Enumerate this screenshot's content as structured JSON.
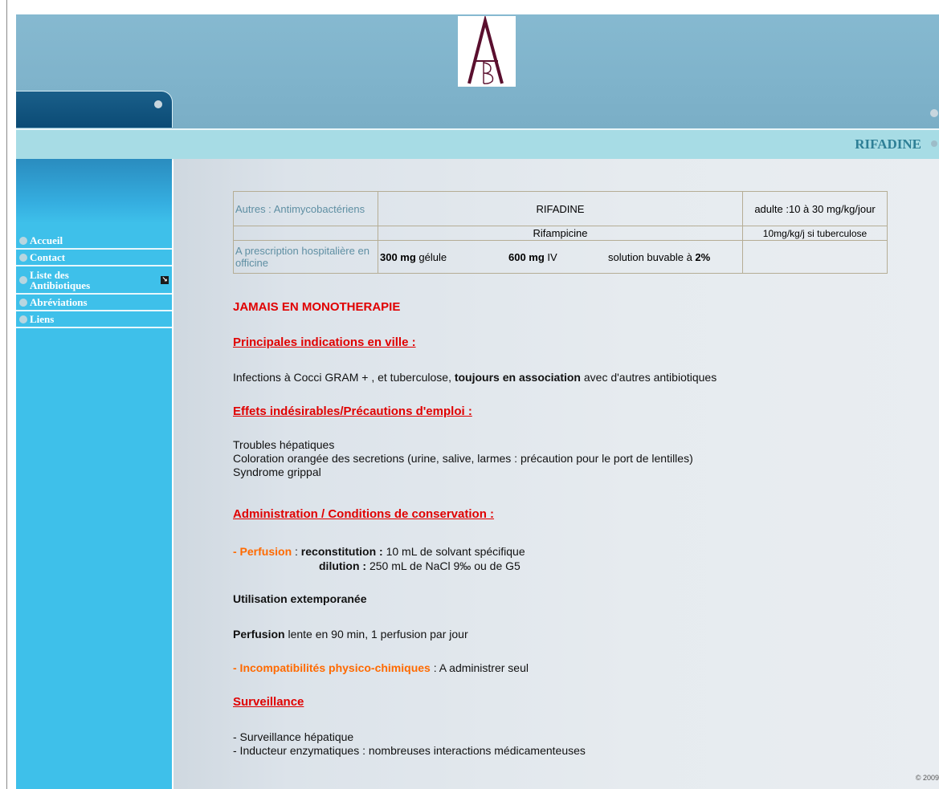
{
  "logo_alt": "AB",
  "header": {
    "title": "RIFADINE"
  },
  "menu": [
    {
      "label": "Accueil"
    },
    {
      "label": "Contact"
    },
    {
      "label": "Liste des Antibiotiques"
    },
    {
      "label": "Abréviations"
    },
    {
      "label": "Liens"
    }
  ],
  "table": {
    "class_label": "Autres : Antimycobactériens",
    "drug_name": "RIFADINE",
    "dose_adult": "adulte :10 à 30 mg/kg/jour",
    "generic_name": "Rifampicine",
    "dose_tb": "10mg/kg/j si tuberculose",
    "prescription": "A prescription hospitalière en officine",
    "form1_dose": "300 mg",
    "form1_type": " gélule",
    "form2_dose": "600 mg",
    "form2_type": " IV",
    "form3_text": "solution buvable à ",
    "form3_dose": "2%"
  },
  "content": {
    "warning": "JAMAIS EN MONOTHERAPIE",
    "h_indications": "Principales indications en ville :",
    "indications_pre": "Infections à Cocci GRAM + , et tuberculose, ",
    "indications_bold": "toujours en association",
    "indications_post": " avec d'autres antibiotiques",
    "h_effets": "Effets indésirables/Précautions d'emploi :",
    "effet1": "Troubles hépatiques",
    "effet2": "Coloration orangée des secretions (urine, salive, larmes : précaution pour le port de lentilles)",
    "effet3": "Syndrome grippal",
    "h_admin": "Administration / Conditions de conservation :",
    "perfusion_label": "- Perfusion",
    "perfusion_sep": " : ",
    "reconstitution_label": "reconstitution :",
    "reconstitution_text": " 10 mL de solvant spécifique",
    "dilution_label": "dilution :",
    "dilution_text": " 250 mL de NaCl 9‰ ou de G5",
    "extemporanee": "Utilisation extemporanée",
    "perf_lente_bold": "Perfusion",
    "perf_lente_text": " lente en 90 min, 1 perfusion par jour",
    "incompat_label": "- Incompatibilités physico-chimiques",
    "incompat_text": " : A administrer seul",
    "h_surveillance": "Surveillance",
    "surv1": "- Surveillance hépatique",
    "surv2": "- Inducteur enzymatiques : nombreuses interactions médicamenteuses"
  },
  "footer": {
    "copyright": "© 2009"
  },
  "colors": {
    "header_blue": "#7fb3cb",
    "sidebar": "#3ec0ea",
    "title_teal": "#2e7f96",
    "red": "#e00000",
    "orange": "#ff6a00"
  }
}
